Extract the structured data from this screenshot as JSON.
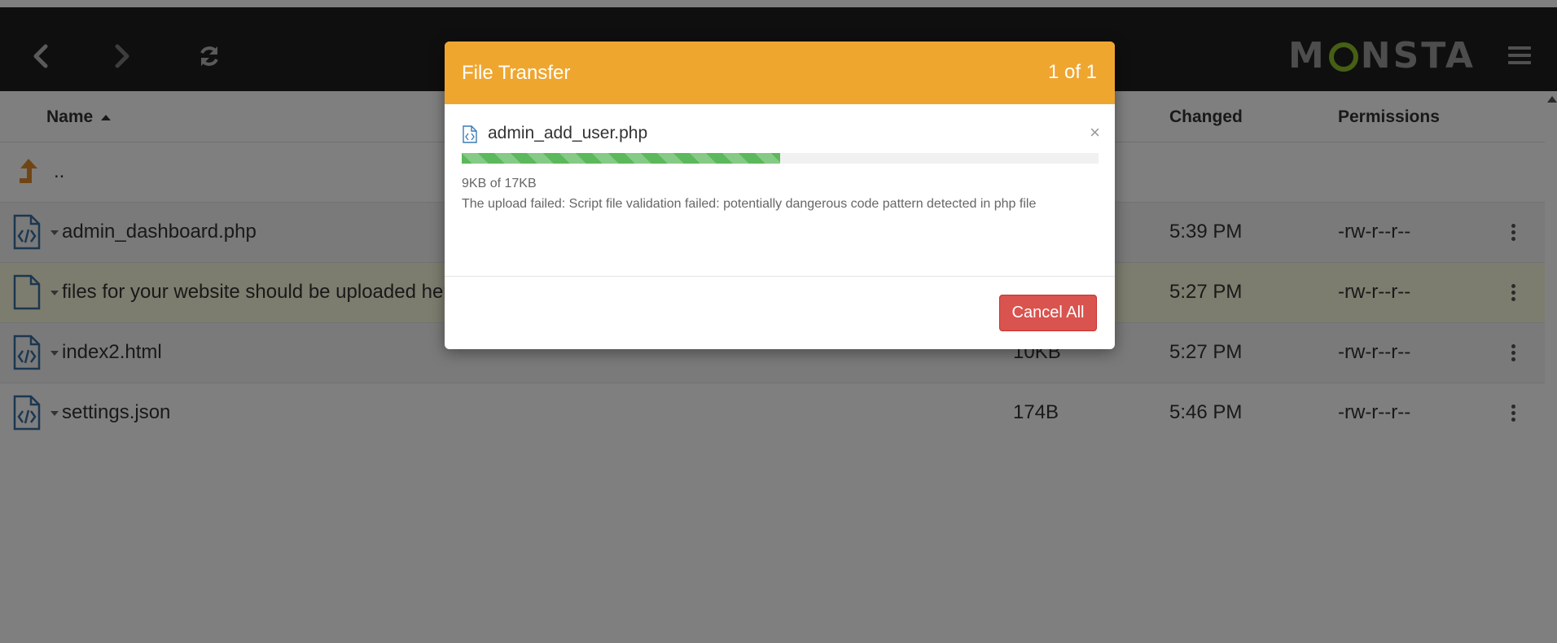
{
  "app": {
    "logo_left": "M",
    "logo_right": "NSTA",
    "icons": [
      "back-icon",
      "forward-icon",
      "refresh-icon",
      "menu-icon"
    ]
  },
  "table": {
    "columns": {
      "name": "Name",
      "changed": "Changed",
      "permissions": "Permissions"
    },
    "parent_label": "..",
    "rows": [
      {
        "name": "admin_dashboard.php",
        "size": "",
        "changed": "5:39 PM",
        "permissions": "-rw-r--r--",
        "icon": "code-file-icon"
      },
      {
        "name": "files for your website should be uploaded here",
        "size": "",
        "changed": "5:27 PM",
        "permissions": "-rw-r--r--",
        "icon": "file-icon"
      },
      {
        "name": "index2.html",
        "size": "10KB",
        "changed": "5:27 PM",
        "permissions": "-rw-r--r--",
        "icon": "code-file-icon"
      },
      {
        "name": "settings.json",
        "size": "174B",
        "changed": "5:46 PM",
        "permissions": "-rw-r--r--",
        "icon": "code-file-icon"
      }
    ]
  },
  "modal": {
    "title": "File Transfer",
    "count": "1 of 1",
    "file_name": "admin_add_user.php",
    "close_label": "×",
    "progress_fraction": 0.5,
    "size_text": "9KB of 17KB",
    "error_text": "The upload failed: Script file validation failed: potentially dangerous code pattern detected in php file",
    "cancel_label": "Cancel All"
  },
  "colors": {
    "header_bg": "#1f1f1f",
    "modal_header": "#efa62f",
    "progress": "#5cb85c",
    "cancel": "#d9534f",
    "highlight_row": "#fbfbde",
    "logo_accent": "#8cbf2a"
  }
}
